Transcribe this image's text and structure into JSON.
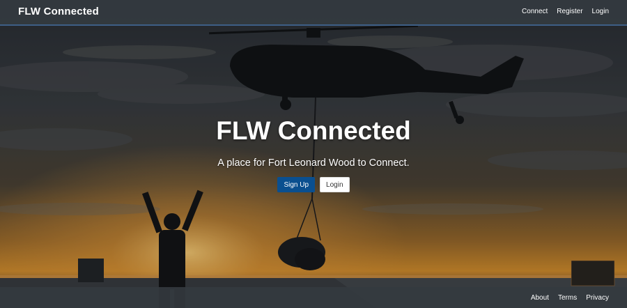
{
  "navbar": {
    "brand": "FLW Connected",
    "links": [
      "Connect",
      "Register",
      "Login"
    ]
  },
  "hero": {
    "title": "FLW Connected",
    "tagline": "A place for Fort Leonard Wood to Connect.",
    "signup_label": "Sign Up",
    "login_label": "Login",
    "background": "sunset-helicopter-deck-photo"
  },
  "footer": {
    "links": [
      "About",
      "Terms",
      "Privacy"
    ]
  },
  "colors": {
    "navbar": "#343a40",
    "navbar_border": "#3e5f86",
    "primary_button": "#0a4f8f",
    "sky_top": "#2b3038",
    "sunset": "#e0a23a"
  }
}
